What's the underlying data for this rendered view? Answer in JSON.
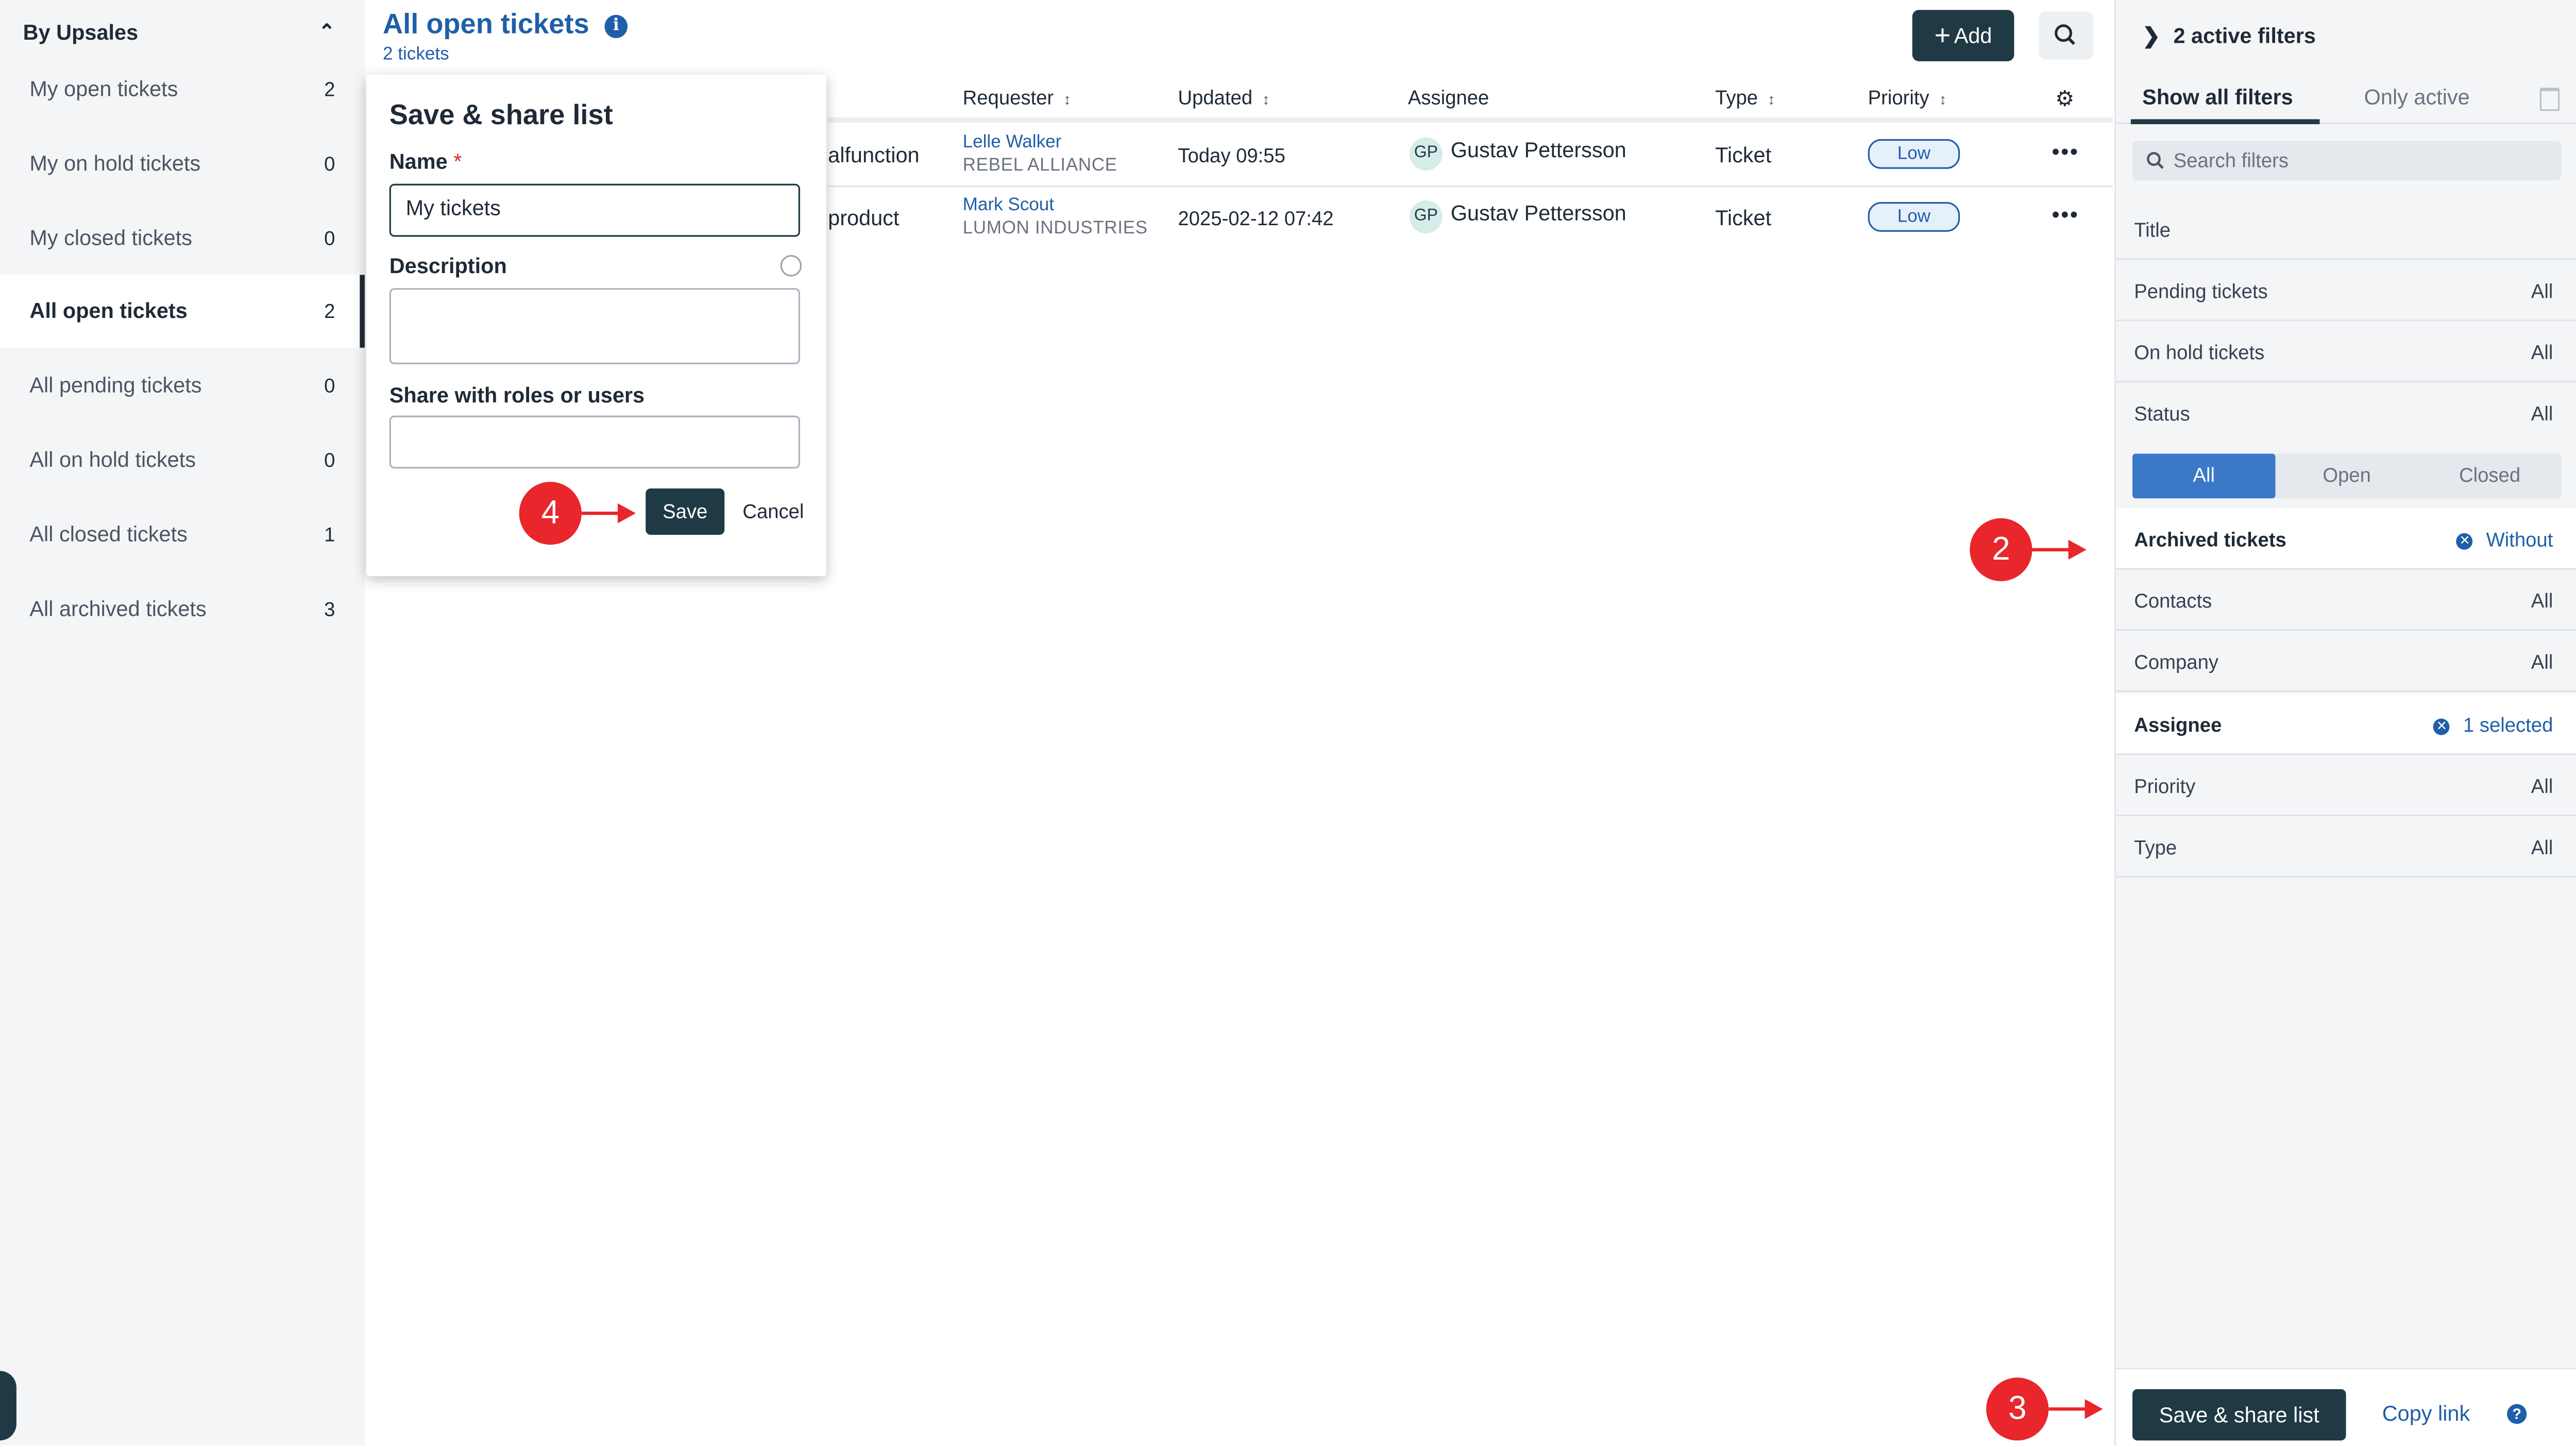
{
  "sidebar": {
    "heading": "By Upsales",
    "items": [
      {
        "label": "My open tickets",
        "count": "2"
      },
      {
        "label": "My on hold tickets",
        "count": "0"
      },
      {
        "label": "My closed tickets",
        "count": "0"
      },
      {
        "label": "All open tickets",
        "count": "2"
      },
      {
        "label": "All pending tickets",
        "count": "0"
      },
      {
        "label": "All on hold tickets",
        "count": "0"
      },
      {
        "label": "All closed tickets",
        "count": "1"
      },
      {
        "label": "All archived tickets",
        "count": "3"
      }
    ]
  },
  "header": {
    "title": "All open tickets",
    "subtitle": "2 tickets",
    "add_label": "Add"
  },
  "table": {
    "columns": [
      "Requester",
      "Updated",
      "Assignee",
      "Type",
      "Priority"
    ],
    "rows": [
      {
        "subject": "alfunction",
        "requester_name": "Lelle Walker",
        "requester_company": "REBEL ALLIANCE",
        "updated": "Today 09:55",
        "assignee_initials": "GP",
        "assignee": "Gustav Pettersson",
        "type": "Ticket",
        "priority": "Low"
      },
      {
        "subject": "product",
        "requester_name": "Mark Scout",
        "requester_company": "LUMON INDUSTRIES",
        "updated": "2025-02-12 07:42",
        "assignee_initials": "GP",
        "assignee": "Gustav Pettersson",
        "type": "Ticket",
        "priority": "Low"
      }
    ]
  },
  "modal": {
    "title": "Save & share list",
    "name_label": "Name",
    "required_mark": "*",
    "name_value": "My tickets",
    "description_label": "Description",
    "share_label": "Share with roles or users",
    "save_label": "Save",
    "cancel_label": "Cancel"
  },
  "annotations": {
    "step2": "2",
    "step3": "3",
    "step4": "4",
    "color": "#e8262b"
  },
  "filters": {
    "header": "2 active filters",
    "tabs": [
      "Show all filters",
      "Only active"
    ],
    "search_placeholder": "Search filters",
    "rows": [
      {
        "label": "Title",
        "value": ""
      },
      {
        "label": "Pending tickets",
        "value": "All"
      },
      {
        "label": "On hold tickets",
        "value": "All"
      },
      {
        "label": "Status",
        "value": "All"
      }
    ],
    "status_options": [
      "All",
      "Open",
      "Closed"
    ],
    "rows2": [
      {
        "label": "Archived tickets",
        "value": "Without",
        "active": true
      },
      {
        "label": "Contacts",
        "value": "All"
      },
      {
        "label": "Company",
        "value": "All"
      },
      {
        "label": "Assignee",
        "value": "1 selected",
        "active": true
      },
      {
        "label": "Priority",
        "value": "All"
      },
      {
        "label": "Type",
        "value": "All"
      }
    ],
    "save_share_label": "Save & share list",
    "copy_link_label": "Copy link"
  },
  "colors": {
    "brand_dark": "#1f3a44",
    "link_blue": "#1f5fa8",
    "active_blue": "#3a78c8"
  }
}
